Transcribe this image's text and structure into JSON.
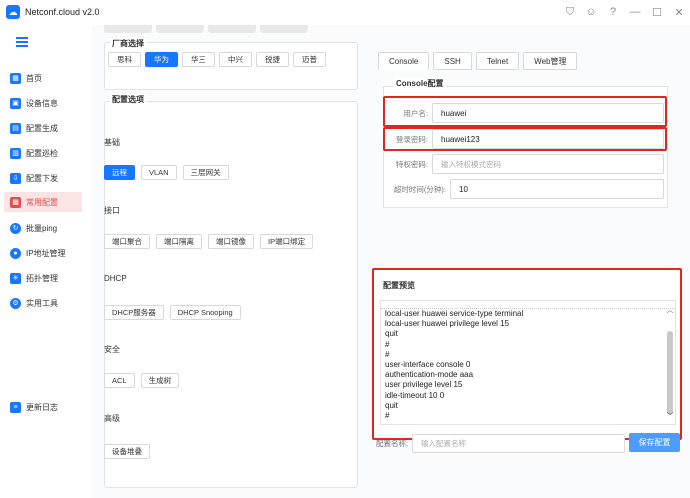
{
  "app": {
    "title": "Netconf.cloud v2.0"
  },
  "sidebar": {
    "items": [
      {
        "label": "首页",
        "icon": "grid-icon"
      },
      {
        "label": "设备信息",
        "icon": "device-info-icon"
      },
      {
        "label": "配置生成",
        "icon": "config-generate-icon"
      },
      {
        "label": "配置巡检",
        "icon": "config-inspect-icon"
      },
      {
        "label": "配置下发",
        "icon": "config-deploy-icon"
      },
      {
        "label": "常用配置",
        "icon": "common-config-icon"
      },
      {
        "label": "批量ping",
        "icon": "ping-icon"
      },
      {
        "label": "IP地址管理",
        "icon": "ip-manage-icon"
      },
      {
        "label": "拓扑管理",
        "icon": "topology-icon"
      },
      {
        "label": "实用工具",
        "icon": "tools-icon"
      }
    ],
    "footer_item": {
      "label": "更新日志",
      "icon": "changelog-icon"
    }
  },
  "vendor": {
    "title": "厂商选择",
    "options": [
      "思科",
      "华为",
      "华三",
      "中兴",
      "锐捷",
      "迈普"
    ],
    "selected": "华为"
  },
  "options": {
    "title": "配置选项",
    "groups": [
      {
        "label": "基础",
        "buttons": [
          "远程",
          "VLAN",
          "三层网关"
        ]
      },
      {
        "label": "接口",
        "buttons": [
          "端口聚合",
          "端口隔离",
          "端口镜像",
          "IP端口绑定"
        ]
      },
      {
        "label": "DHCP",
        "buttons": [
          "DHCP服务器",
          "DHCP Snooping"
        ]
      },
      {
        "label": "安全",
        "buttons": [
          "ACL",
          "生成树"
        ]
      },
      {
        "label": "高级",
        "buttons": [
          "设备堆叠"
        ]
      }
    ]
  },
  "tabs": [
    "Console",
    "SSH",
    "Telnet",
    "Web管理"
  ],
  "console": {
    "title": "Console配置",
    "username_label": "用户名:",
    "username_value": "huawei",
    "password_label": "登录密码:",
    "password_value": "huawei123",
    "priv_label": "特权密码:",
    "priv_placeholder": "输入特权模式密码",
    "timeout_label": "超时时间(分钟):",
    "timeout_value": "10"
  },
  "preview": {
    "title": "配置预览",
    "lines": [
      "local-user huawei service-type terminal",
      "local-user huawei privilege level 15",
      "quit",
      "#",
      "#",
      "user-interface console 0",
      "authentication-mode aaa",
      "user privilege level 15",
      "idle-timeout 10 0",
      "quit",
      "#"
    ]
  },
  "save": {
    "name_label": "配置名称:",
    "name_placeholder": "输入配置名称",
    "button_label": "保存配置"
  },
  "colors": {
    "accent": "#1677ff",
    "highlight": "#e3261b",
    "active_nav": "#e34d4d"
  }
}
